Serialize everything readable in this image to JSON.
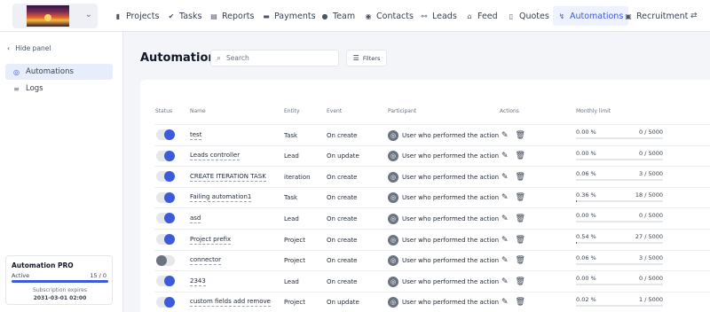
{
  "nav": {
    "items": [
      {
        "label": "Projects",
        "icon": "projects-icon"
      },
      {
        "label": "Tasks",
        "icon": "tasks-icon"
      },
      {
        "label": "Reports",
        "icon": "reports-icon"
      },
      {
        "label": "Payments",
        "icon": "payments-icon"
      },
      {
        "label": "Team",
        "icon": "team-icon"
      },
      {
        "label": "Contacts",
        "icon": "contacts-icon"
      },
      {
        "label": "Leads",
        "icon": "leads-icon"
      },
      {
        "label": "Feed",
        "icon": "feed-icon"
      },
      {
        "label": "Quotes",
        "icon": "quotes-icon"
      },
      {
        "label": "Automations",
        "icon": "automations-icon",
        "active": true
      },
      {
        "label": "Recruitment",
        "icon": "recruitment-icon"
      }
    ]
  },
  "sidebar": {
    "hide_panel": "Hide panel",
    "items": [
      {
        "label": "Automations",
        "icon": "automations-icon",
        "active": true
      },
      {
        "label": "Logs",
        "icon": "logs-icon"
      }
    ]
  },
  "plan": {
    "title": "Automation PRO",
    "active_label": "Active",
    "count": "15 / 0",
    "usage_fraction": 1.0,
    "expires_label": "Subscription expires",
    "expires_date": "2031-03-01 02:00"
  },
  "main": {
    "title": "Automations",
    "search_placeholder": "Search",
    "filters_label": "Filters"
  },
  "table": {
    "headers": {
      "status": "Status",
      "name": "Name",
      "entity": "Entity",
      "event": "Event",
      "participant": "Participant",
      "actions": "Actions",
      "monthly_limit": "Monthly limit"
    },
    "rows": [
      {
        "enabled": true,
        "name": "test",
        "entity": "Task",
        "event": "On create",
        "participant": "User who performed the action",
        "percent": "0.00 %",
        "usage": "0 / 5000",
        "fraction": 0.0
      },
      {
        "enabled": true,
        "name": "Leads controller",
        "entity": "Lead",
        "event": "On update",
        "participant": "User who performed the action",
        "percent": "0.00 %",
        "usage": "0 / 5000",
        "fraction": 0.0
      },
      {
        "enabled": true,
        "name": "CREATE ITERATION TASK",
        "entity": "iteration",
        "event": "On create",
        "participant": "User who performed the action",
        "percent": "0.06 %",
        "usage": "3 / 5000",
        "fraction": 0.0006
      },
      {
        "enabled": true,
        "name": "Failing automation1",
        "entity": "Task",
        "event": "On create",
        "participant": "User who performed the action",
        "percent": "0.36 %",
        "usage": "18 / 5000",
        "fraction": 0.0036
      },
      {
        "enabled": true,
        "name": "asd",
        "entity": "Lead",
        "event": "On create",
        "participant": "User who performed the action",
        "percent": "0.00 %",
        "usage": "0 / 5000",
        "fraction": 0.0
      },
      {
        "enabled": true,
        "name": "Project prefix",
        "entity": "Project",
        "event": "On create",
        "participant": "User who performed the action",
        "percent": "0.54 %",
        "usage": "27 / 5000",
        "fraction": 0.0054
      },
      {
        "enabled": false,
        "name": "connector",
        "entity": "Project",
        "event": "On create",
        "participant": "User who performed the action",
        "percent": "0.06 %",
        "usage": "3 / 5000",
        "fraction": 0.0006
      },
      {
        "enabled": true,
        "name": "2343",
        "entity": "Lead",
        "event": "On create",
        "participant": "User who performed the action",
        "percent": "0.00 %",
        "usage": "0 / 5000",
        "fraction": 0.0
      },
      {
        "enabled": true,
        "name": "custom fields add remove",
        "entity": "Project",
        "event": "On update",
        "participant": "User who performed the action",
        "percent": "0.02 %",
        "usage": "1 / 5000",
        "fraction": 0.0002
      }
    ]
  },
  "colors": {
    "accent": "#3b5bdb",
    "toggle_off": "#6b7280"
  }
}
